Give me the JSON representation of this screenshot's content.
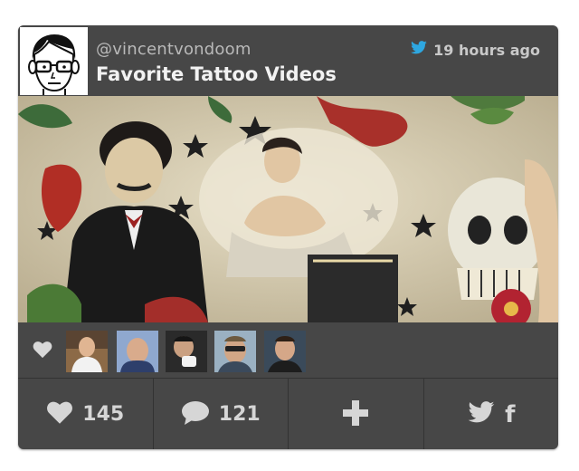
{
  "header": {
    "handle": "@vincentvondoom",
    "title": "Favorite Tattoo Videos",
    "time": "19 hours ago",
    "twitter_color": "#2ea7e0"
  },
  "media": {
    "description": ""
  },
  "likers": {
    "count_avatars": 5
  },
  "actions": {
    "likes": "145",
    "comments": "121",
    "add_icon": "plus-icon",
    "share_icons": [
      "twitter-icon",
      "facebook-icon"
    ]
  }
}
